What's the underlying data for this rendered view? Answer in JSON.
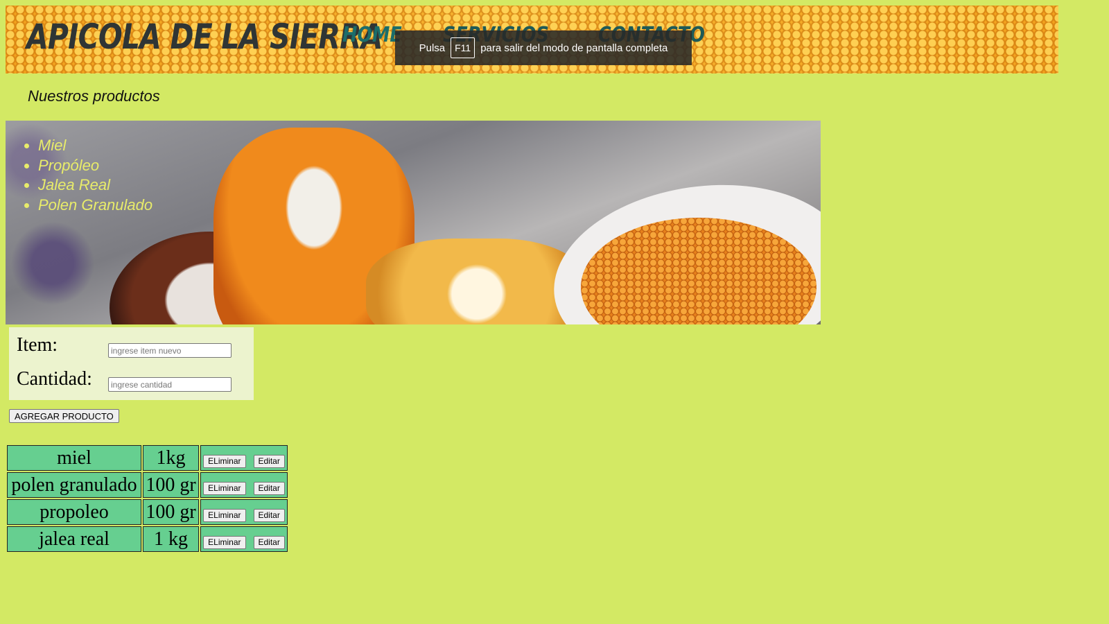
{
  "header": {
    "brand": "APICOLA DE LA SIERRA",
    "nav": [
      "HOME",
      "SERVICIOS",
      "CONTACTO"
    ]
  },
  "fullscreen_toast": {
    "prefix": "Pulsa",
    "key": "F11",
    "suffix": "para salir del modo de pantalla completa"
  },
  "page": {
    "subtitle": "Nuestros productos"
  },
  "banner": {
    "products": [
      "Miel",
      "Propóleo",
      "Jalea Real",
      "Polen Granulado"
    ]
  },
  "form": {
    "item_label": "Item:",
    "item_placeholder": "ingrese item nuevo",
    "quantity_label": "Cantidad:",
    "quantity_placeholder": "ingrese cantidad",
    "add_button": "AGREGAR PRODUCTO"
  },
  "table": {
    "delete_label": "ELiminar",
    "edit_label": "Editar",
    "rows": [
      {
        "item": "miel",
        "qty": "1kg"
      },
      {
        "item": "polen granulado",
        "qty": "100 gr"
      },
      {
        "item": "propoleo",
        "qty": "100 gr"
      },
      {
        "item": "jalea real",
        "qty": "1 kg"
      }
    ]
  },
  "colors": {
    "page_bg": "#d3e964",
    "table_cell_bg": "#66cf90",
    "nav_text": "#1b6d6a",
    "header_bg": "#f5a623"
  }
}
